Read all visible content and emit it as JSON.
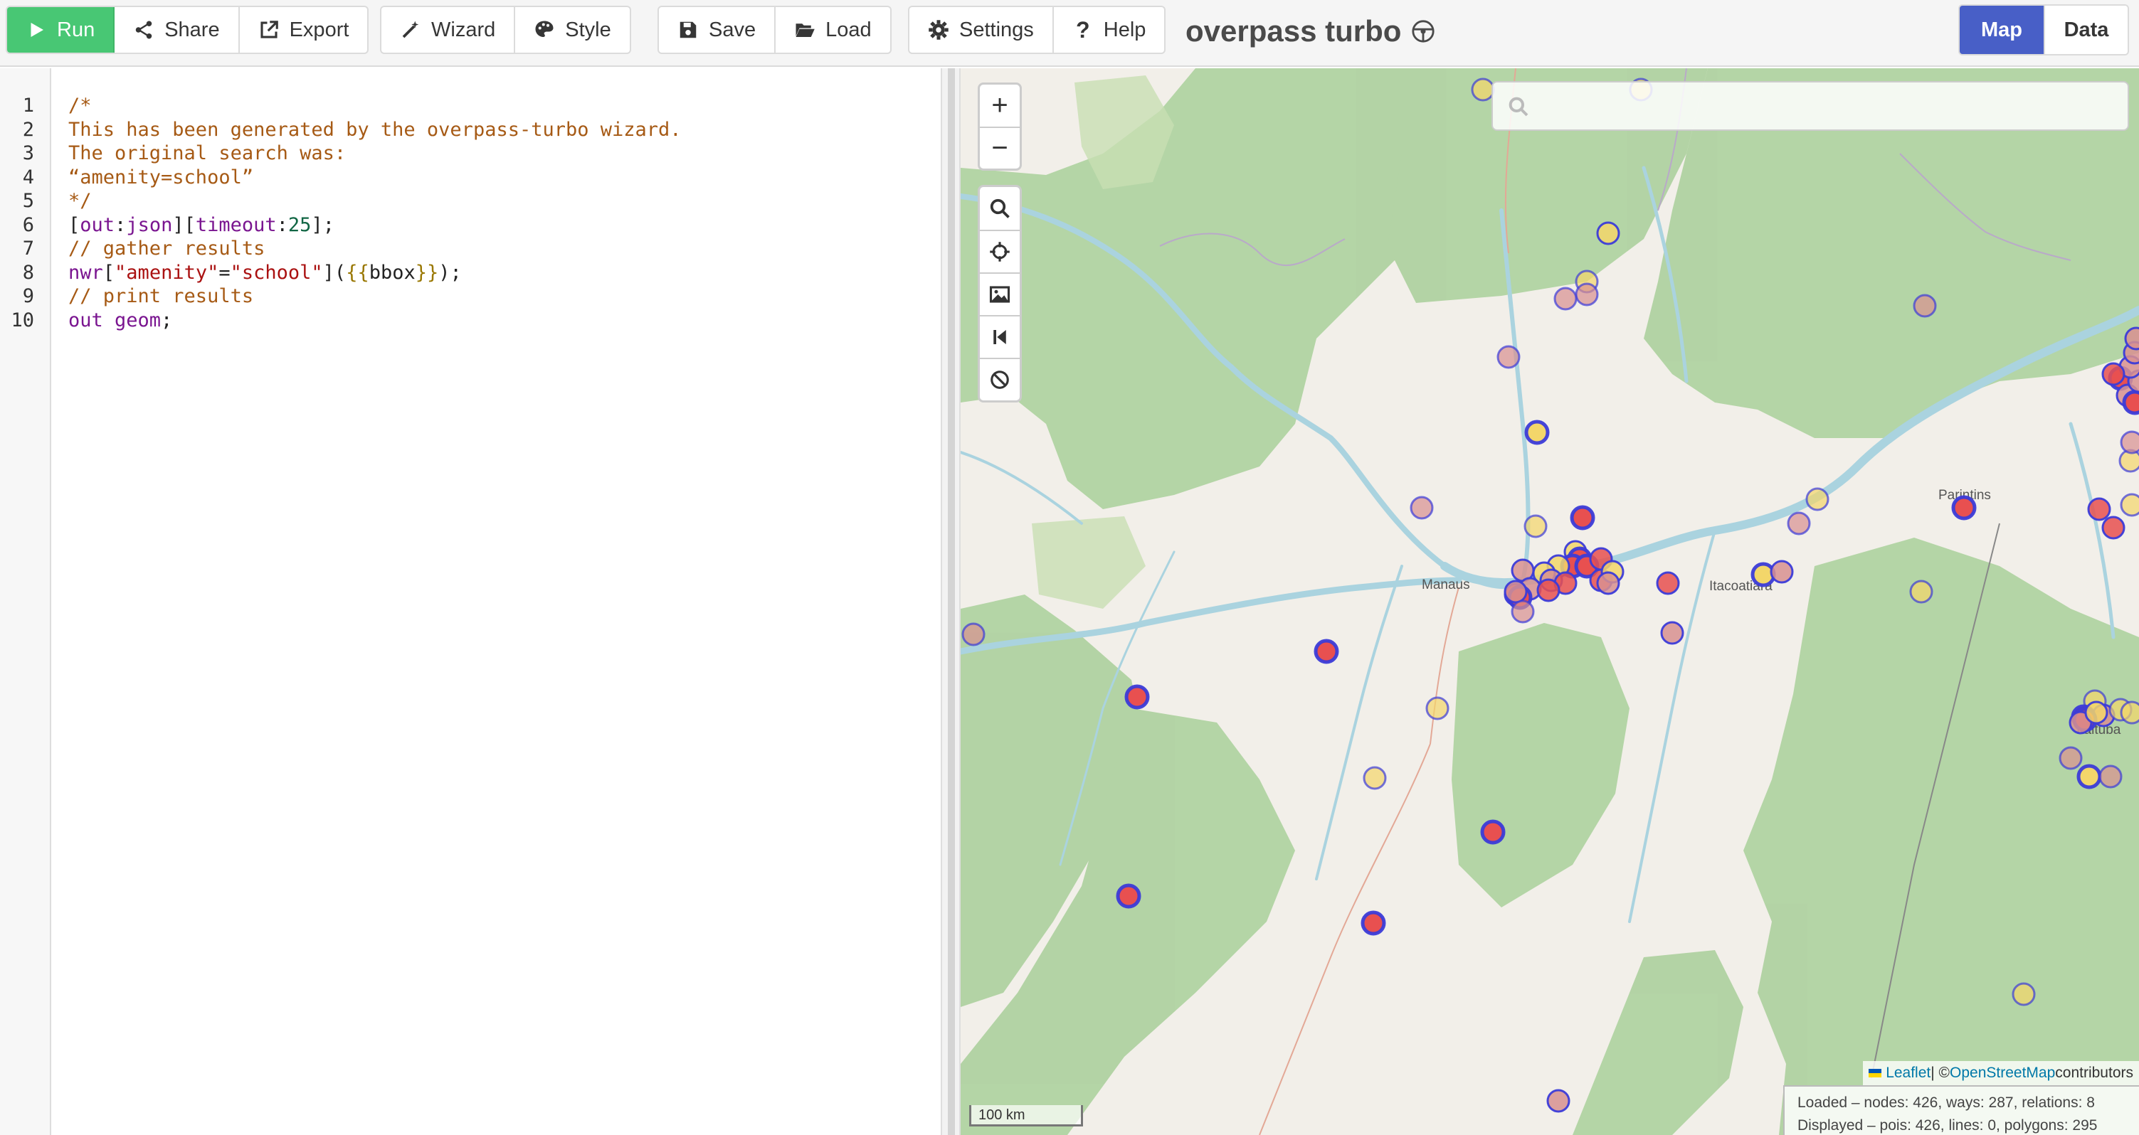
{
  "toolbar": {
    "run": "Run",
    "share": "Share",
    "export": "Export",
    "wizard": "Wizard",
    "style": "Style",
    "save": "Save",
    "load": "Load",
    "settings": "Settings",
    "help": "Help"
  },
  "app_title": "overpass turbo",
  "views": {
    "map": "Map",
    "data": "Data",
    "active": "Map"
  },
  "editor": {
    "line_numbers": [
      "1",
      "2",
      "3",
      "4",
      "5",
      "6",
      "7",
      "8",
      "9",
      "10"
    ],
    "lines": {
      "l1": "/*",
      "l2": "This has been generated by the overpass-turbo wizard.",
      "l3": "The original search was:",
      "l4": "“amenity=school”",
      "l5": "*/",
      "l6_a": "[",
      "l6_b": "out",
      "l6_c": ":",
      "l6_d": "json",
      "l6_e": "][",
      "l6_f": "timeout",
      "l6_g": ":",
      "l6_h": "25",
      "l6_i": "];",
      "l7": "// gather results",
      "l8_a": "nwr",
      "l8_b": "[",
      "l8_c": "\"amenity\"",
      "l8_d": "=",
      "l8_e": "\"school\"",
      "l8_f": "](",
      "l8_g": "{{",
      "l8_h": "bbox",
      "l8_i": "}}",
      "l8_j": ");",
      "l9": "// print results",
      "l10_a": "out geom",
      "l10_b": ";"
    }
  },
  "map": {
    "search_placeholder": "",
    "zoom_in": "+",
    "zoom_out": "−",
    "places": {
      "manaus": "Manaus",
      "itacoatiara": "Itacoatiara",
      "parintins": "Parintins",
      "itaituba": "Itaituba"
    },
    "scale_label": "100 km",
    "attribution": {
      "leaflet": "Leaflet",
      "sep": " | © ",
      "osm": "OpenStreetMap",
      "contributors": " contributors"
    },
    "stats": {
      "loaded": "Loaded – nodes: 426, ways: 287, relations: 8",
      "displayed": "Displayed – pois: 426, lines: 0, polygons: 295"
    },
    "colors": {
      "water": "#aad3df",
      "forest": "#add19e",
      "land": "#f2efe9",
      "poi_stroke": "#3b3bd8",
      "poi_fill_red": "#e85050",
      "poi_fill_yellow": "#f3d66a",
      "poi_fill_pink": "#d89090"
    }
  }
}
